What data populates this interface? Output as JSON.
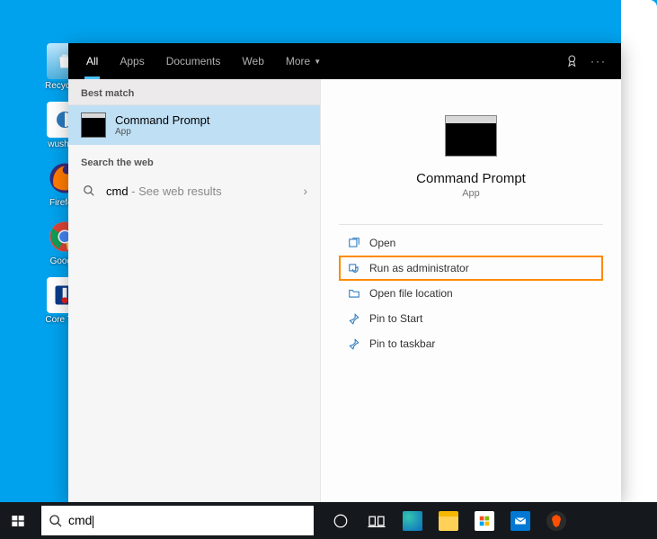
{
  "desktop": {
    "icons": [
      {
        "label": "Recycle..."
      },
      {
        "label": "wusho..."
      },
      {
        "label": "Firefo..."
      },
      {
        "label": "Goog..."
      },
      {
        "label": "Core Te..."
      }
    ]
  },
  "tabs": {
    "items": [
      "All",
      "Apps",
      "Documents",
      "Web",
      "More"
    ],
    "active_index": 0
  },
  "left": {
    "best_match_header": "Best match",
    "best_match": {
      "title": "Command Prompt",
      "subtitle": "App"
    },
    "search_the_web_header": "Search the web",
    "web": {
      "query": "cmd",
      "suffix": " - See web results"
    }
  },
  "right": {
    "title": "Command Prompt",
    "subtitle": "App",
    "actions": [
      "Open",
      "Run as administrator",
      "Open file location",
      "Pin to Start",
      "Pin to taskbar"
    ],
    "highlight_index": 1
  },
  "taskbar": {
    "search_value": "cmd"
  }
}
